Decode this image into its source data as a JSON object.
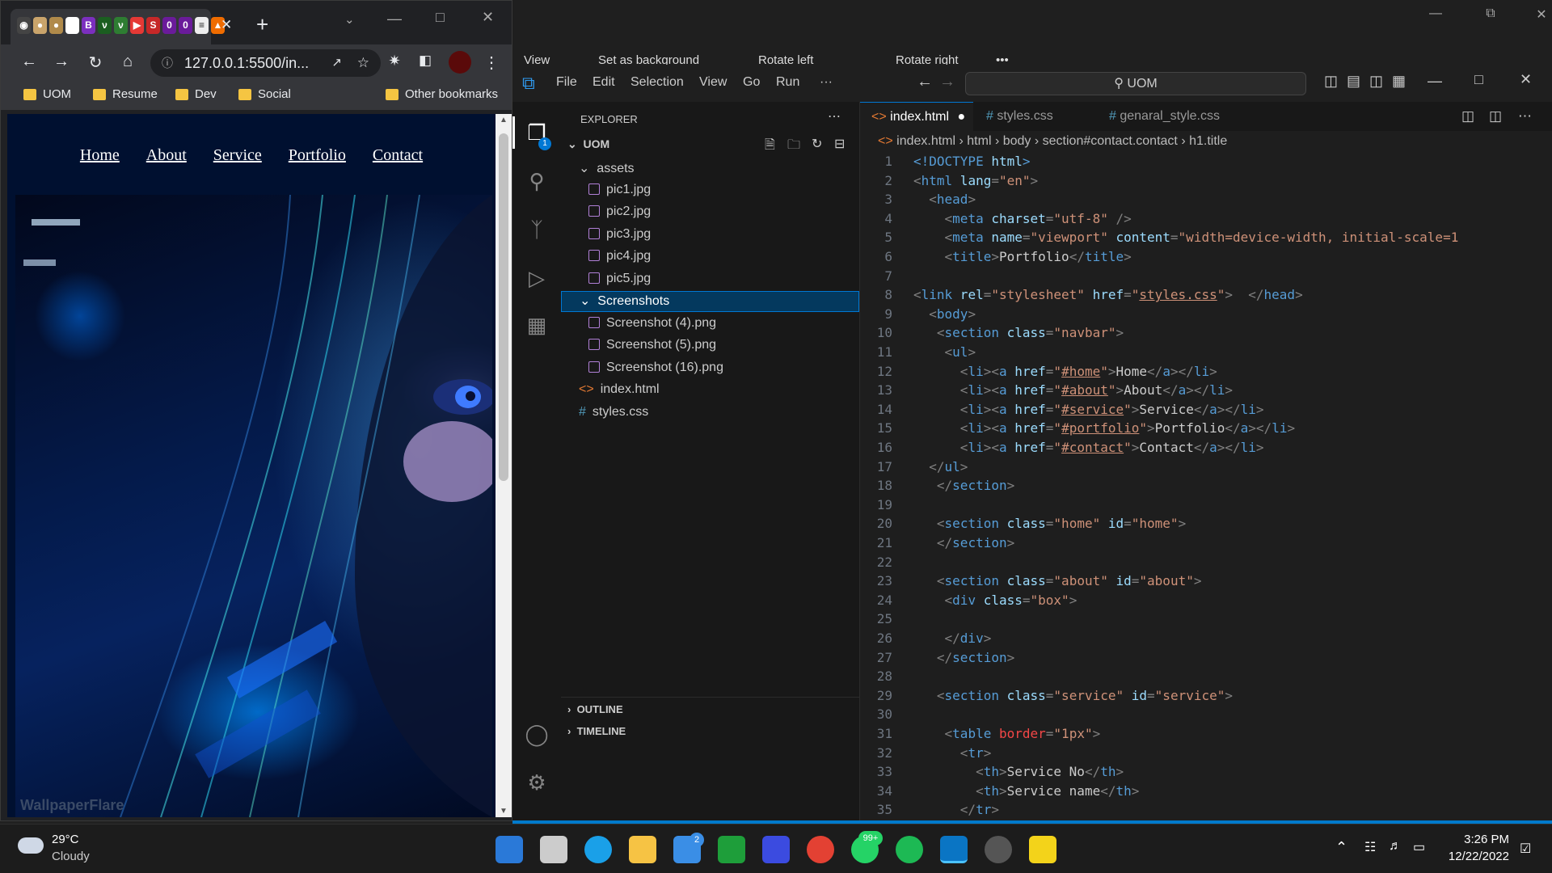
{
  "photo_viewer": {
    "view_label": "View",
    "set_background_label": "Set as background",
    "rotate_left_label": "Rotate left",
    "rotate_right_label": "Rotate right",
    "more": "•••"
  },
  "chrome": {
    "close_tab": "✕",
    "new_tab": "+",
    "url": "127.0.0.1:5500/in...",
    "bookmarks": [
      "UOM",
      "Resume",
      "Dev",
      "Social"
    ],
    "other_bookmarks": "Other bookmarks",
    "tab_favicon_letters": [
      "B",
      "S",
      "0",
      "0"
    ]
  },
  "website": {
    "nav": [
      "Home",
      "About",
      "Service",
      "Portfolio",
      "Contact"
    ],
    "watermark": "WallpaperFlare"
  },
  "vscode": {
    "menu": [
      "File",
      "Edit",
      "Selection",
      "View",
      "Go",
      "Run",
      "···"
    ],
    "search": "UOM",
    "explorer_title": "EXPLORER",
    "explorer_badge": "1",
    "root": "UOM",
    "tree": {
      "assets": "assets",
      "files_assets": [
        "pic1.jpg",
        "pic2.jpg",
        "pic3.jpg",
        "pic4.jpg",
        "pic5.jpg"
      ],
      "screenshots": "Screenshots",
      "files_screenshots": [
        "Screenshot (4).png",
        "Screenshot (5).png",
        "Screenshot (16).png"
      ],
      "index": "index.html",
      "styles": "styles.css"
    },
    "outline": "OUTLINE",
    "timeline": "TIMELINE",
    "tabs": [
      "index.html",
      "styles.css",
      "genaral_style.css"
    ],
    "breadcrumbs": [
      "index.html",
      "html",
      "body",
      "section#contact.contact",
      "h1.title"
    ],
    "line_numbers": [
      "1",
      "2",
      "3",
      "4",
      "5",
      "6",
      "7",
      "8",
      "9",
      "10",
      "11",
      "12",
      "13",
      "14",
      "15",
      "16",
      "17",
      "18",
      "19",
      "20",
      "21",
      "22",
      "23",
      "24",
      "25",
      "26",
      "27",
      "28",
      "29",
      "30",
      "31",
      "32",
      "33",
      "34",
      "35"
    ]
  },
  "code": [
    {
      "p": [
        [
          "t",
          "<!DOCTYPE"
        ],
        [
          "a",
          " html"
        ],
        [
          "t",
          ">"
        ]
      ]
    },
    {
      "p": [
        [
          "br",
          "<"
        ],
        [
          "t",
          "html"
        ],
        [
          "a",
          " lang"
        ],
        [
          "br",
          "="
        ],
        [
          "s",
          "\"en\""
        ],
        [
          "br",
          ">"
        ]
      ]
    },
    {
      "p": [
        [
          "",
          "  "
        ],
        [
          "br",
          "<"
        ],
        [
          "t",
          "head"
        ],
        [
          "br",
          ">"
        ]
      ]
    },
    {
      "p": [
        [
          "",
          "    "
        ],
        [
          "br",
          "<"
        ],
        [
          "t",
          "meta"
        ],
        [
          "a",
          " charset"
        ],
        [
          "br",
          "="
        ],
        [
          "s",
          "\"utf-8\""
        ],
        [
          "br",
          " />"
        ]
      ]
    },
    {
      "p": [
        [
          "",
          "    "
        ],
        [
          "br",
          "<"
        ],
        [
          "t",
          "meta"
        ],
        [
          "a",
          " name"
        ],
        [
          "br",
          "="
        ],
        [
          "s",
          "\"viewport\""
        ],
        [
          "a",
          " content"
        ],
        [
          "br",
          "="
        ],
        [
          "s",
          "\"width=device-width, initial-scale=1"
        ]
      ]
    },
    {
      "p": [
        [
          "",
          "    "
        ],
        [
          "br",
          "<"
        ],
        [
          "t",
          "title"
        ],
        [
          "br",
          ">"
        ],
        [
          "",
          "Portfolio"
        ],
        [
          "br",
          "</"
        ],
        [
          "t",
          "title"
        ],
        [
          "br",
          ">"
        ]
      ]
    },
    {
      "p": []
    },
    {
      "p": [
        [
          "br",
          "<"
        ],
        [
          "t",
          "link"
        ],
        [
          "a",
          " rel"
        ],
        [
          "br",
          "="
        ],
        [
          "s",
          "\"stylesheet\""
        ],
        [
          "a",
          " href"
        ],
        [
          "br",
          "="
        ],
        [
          "s",
          "\""
        ],
        [
          "su",
          "styles.css"
        ],
        [
          "s",
          "\""
        ],
        [
          "br",
          ">"
        ],
        [
          "",
          "  "
        ],
        [
          "br",
          "</"
        ],
        [
          "t",
          "head"
        ],
        [
          "br",
          ">"
        ]
      ]
    },
    {
      "p": [
        [
          "",
          "  "
        ],
        [
          "br",
          "<"
        ],
        [
          "t",
          "body"
        ],
        [
          "br",
          ">"
        ]
      ]
    },
    {
      "p": [
        [
          "",
          "   "
        ],
        [
          "br",
          "<"
        ],
        [
          "t",
          "section"
        ],
        [
          "a",
          " class"
        ],
        [
          "br",
          "="
        ],
        [
          "s",
          "\"navbar\""
        ],
        [
          "br",
          ">"
        ]
      ]
    },
    {
      "p": [
        [
          "",
          "    "
        ],
        [
          "br",
          "<"
        ],
        [
          "t",
          "ul"
        ],
        [
          "br",
          ">"
        ]
      ]
    },
    {
      "p": [
        [
          "",
          "      "
        ],
        [
          "br",
          "<"
        ],
        [
          "t",
          "li"
        ],
        [
          "br",
          "><"
        ],
        [
          "t",
          "a"
        ],
        [
          "a",
          " href"
        ],
        [
          "br",
          "="
        ],
        [
          "s",
          "\""
        ],
        [
          "su",
          "#home"
        ],
        [
          "s",
          "\""
        ],
        [
          "br",
          ">"
        ],
        [
          "",
          "Home"
        ],
        [
          "br",
          "</"
        ],
        [
          "t",
          "a"
        ],
        [
          "br",
          "></"
        ],
        [
          "t",
          "li"
        ],
        [
          "br",
          ">"
        ]
      ]
    },
    {
      "p": [
        [
          "",
          "      "
        ],
        [
          "br",
          "<"
        ],
        [
          "t",
          "li"
        ],
        [
          "br",
          "><"
        ],
        [
          "t",
          "a"
        ],
        [
          "a",
          " href"
        ],
        [
          "br",
          "="
        ],
        [
          "s",
          "\""
        ],
        [
          "su",
          "#about"
        ],
        [
          "s",
          "\""
        ],
        [
          "br",
          ">"
        ],
        [
          "",
          "About"
        ],
        [
          "br",
          "</"
        ],
        [
          "t",
          "a"
        ],
        [
          "br",
          "></"
        ],
        [
          "t",
          "li"
        ],
        [
          "br",
          ">"
        ]
      ]
    },
    {
      "p": [
        [
          "",
          "      "
        ],
        [
          "br",
          "<"
        ],
        [
          "t",
          "li"
        ],
        [
          "br",
          "><"
        ],
        [
          "t",
          "a"
        ],
        [
          "a",
          " href"
        ],
        [
          "br",
          "="
        ],
        [
          "s",
          "\""
        ],
        [
          "su",
          "#service"
        ],
        [
          "s",
          "\""
        ],
        [
          "br",
          ">"
        ],
        [
          "",
          "Service"
        ],
        [
          "br",
          "</"
        ],
        [
          "t",
          "a"
        ],
        [
          "br",
          "></"
        ],
        [
          "t",
          "li"
        ],
        [
          "br",
          ">"
        ]
      ]
    },
    {
      "p": [
        [
          "",
          "      "
        ],
        [
          "br",
          "<"
        ],
        [
          "t",
          "li"
        ],
        [
          "br",
          "><"
        ],
        [
          "t",
          "a"
        ],
        [
          "a",
          " href"
        ],
        [
          "br",
          "="
        ],
        [
          "s",
          "\""
        ],
        [
          "su",
          "#portfolio"
        ],
        [
          "s",
          "\""
        ],
        [
          "br",
          ">"
        ],
        [
          "",
          "Portfolio"
        ],
        [
          "br",
          "</"
        ],
        [
          "t",
          "a"
        ],
        [
          "br",
          "></"
        ],
        [
          "t",
          "li"
        ],
        [
          "br",
          ">"
        ]
      ]
    },
    {
      "p": [
        [
          "",
          "      "
        ],
        [
          "br",
          "<"
        ],
        [
          "t",
          "li"
        ],
        [
          "br",
          "><"
        ],
        [
          "t",
          "a"
        ],
        [
          "a",
          " href"
        ],
        [
          "br",
          "="
        ],
        [
          "s",
          "\""
        ],
        [
          "su",
          "#contact"
        ],
        [
          "s",
          "\""
        ],
        [
          "br",
          ">"
        ],
        [
          "",
          "Contact"
        ],
        [
          "br",
          "</"
        ],
        [
          "t",
          "a"
        ],
        [
          "br",
          "></"
        ],
        [
          "t",
          "li"
        ],
        [
          "br",
          ">"
        ]
      ]
    },
    {
      "p": [
        [
          "",
          "  "
        ],
        [
          "br",
          "</"
        ],
        [
          "t",
          "ul"
        ],
        [
          "br",
          ">"
        ]
      ]
    },
    {
      "p": [
        [
          "",
          "   "
        ],
        [
          "br",
          "</"
        ],
        [
          "t",
          "section"
        ],
        [
          "br",
          ">"
        ]
      ]
    },
    {
      "p": []
    },
    {
      "p": [
        [
          "",
          "   "
        ],
        [
          "br",
          "<"
        ],
        [
          "t",
          "section"
        ],
        [
          "a",
          " class"
        ],
        [
          "br",
          "="
        ],
        [
          "s",
          "\"home\""
        ],
        [
          "a",
          " id"
        ],
        [
          "br",
          "="
        ],
        [
          "s",
          "\"home\""
        ],
        [
          "br",
          ">"
        ]
      ]
    },
    {
      "p": [
        [
          "",
          "   "
        ],
        [
          "br",
          "</"
        ],
        [
          "t",
          "section"
        ],
        [
          "br",
          ">"
        ]
      ]
    },
    {
      "p": []
    },
    {
      "p": [
        [
          "",
          "   "
        ],
        [
          "br",
          "<"
        ],
        [
          "t",
          "section"
        ],
        [
          "a",
          " class"
        ],
        [
          "br",
          "="
        ],
        [
          "s",
          "\"about\""
        ],
        [
          "a",
          " id"
        ],
        [
          "br",
          "="
        ],
        [
          "s",
          "\"about\""
        ],
        [
          "br",
          ">"
        ]
      ]
    },
    {
      "p": [
        [
          "",
          "    "
        ],
        [
          "br",
          "<"
        ],
        [
          "t",
          "div"
        ],
        [
          "a",
          " class"
        ],
        [
          "br",
          "="
        ],
        [
          "s",
          "\"box\""
        ],
        [
          "br",
          ">"
        ]
      ]
    },
    {
      "p": []
    },
    {
      "p": [
        [
          "",
          "    "
        ],
        [
          "br",
          "</"
        ],
        [
          "t",
          "div"
        ],
        [
          "br",
          ">"
        ]
      ]
    },
    {
      "p": [
        [
          "",
          "   "
        ],
        [
          "br",
          "</"
        ],
        [
          "t",
          "section"
        ],
        [
          "br",
          ">"
        ]
      ]
    },
    {
      "p": []
    },
    {
      "p": [
        [
          "",
          "   "
        ],
        [
          "br",
          "<"
        ],
        [
          "t",
          "section"
        ],
        [
          "a",
          " class"
        ],
        [
          "br",
          "="
        ],
        [
          "s",
          "\"service\""
        ],
        [
          "a",
          " id"
        ],
        [
          "br",
          "="
        ],
        [
          "s",
          "\"service\""
        ],
        [
          "br",
          ">"
        ]
      ]
    },
    {
      "p": []
    },
    {
      "p": [
        [
          "",
          "    "
        ],
        [
          "br",
          "<"
        ],
        [
          "t",
          "table"
        ],
        [
          "ar",
          " border"
        ],
        [
          "br",
          "="
        ],
        [
          "s",
          "\"1px\""
        ],
        [
          "br",
          ">"
        ]
      ]
    },
    {
      "p": [
        [
          "",
          "      "
        ],
        [
          "br",
          "<"
        ],
        [
          "t",
          "tr"
        ],
        [
          "br",
          ">"
        ]
      ]
    },
    {
      "p": [
        [
          "",
          "        "
        ],
        [
          "br",
          "<"
        ],
        [
          "t",
          "th"
        ],
        [
          "br",
          ">"
        ],
        [
          "",
          "Service No"
        ],
        [
          "br",
          "</"
        ],
        [
          "t",
          "th"
        ],
        [
          "br",
          ">"
        ]
      ]
    },
    {
      "p": [
        [
          "",
          "        "
        ],
        [
          "br",
          "<"
        ],
        [
          "t",
          "th"
        ],
        [
          "br",
          ">"
        ],
        [
          "",
          "Service name"
        ],
        [
          "br",
          "</"
        ],
        [
          "t",
          "th"
        ],
        [
          "br",
          ">"
        ]
      ]
    },
    {
      "p": [
        [
          "",
          "      "
        ],
        [
          "br",
          "</"
        ],
        [
          "t",
          "tr"
        ],
        [
          "br",
          ">"
        ]
      ]
    }
  ],
  "taskbar": {
    "temperature": "29°C",
    "weather": "Cloudy",
    "time": "3:26 PM",
    "date": "12/22/2022",
    "mail_badge": "2",
    "whatsapp_badge": "99+"
  },
  "colors": {
    "vscode_accent": "#007acc",
    "selection": "#04395e",
    "website_bg": "#001030"
  }
}
